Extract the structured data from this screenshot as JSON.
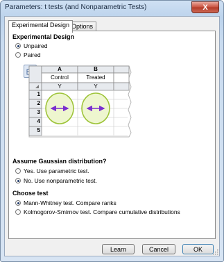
{
  "window": {
    "title": "Parameters: t tests (and Nonparametric Tests)",
    "close_glyph": "X"
  },
  "tabs": [
    {
      "label": "Experimental Design",
      "active": true
    },
    {
      "label": "Options",
      "active": false
    }
  ],
  "experimental_design": {
    "heading": "Experimental Design",
    "options": [
      {
        "label": "Unpaired",
        "checked": true
      },
      {
        "label": "Paired",
        "checked": false
      }
    ]
  },
  "table_preview": {
    "columns": [
      {
        "letter": "A",
        "title": "Control",
        "subhead": "Y"
      },
      {
        "letter": "B",
        "title": "Treated",
        "subhead": "Y"
      }
    ],
    "row_numbers": [
      "1",
      "2",
      "3",
      "4",
      "5"
    ],
    "colors": {
      "accent": "#7a2fcf",
      "ellipse_fill": "#eef6cf",
      "ellipse_stroke": "#9ec43a",
      "header_fill": "#e7eaee"
    }
  },
  "gaussian": {
    "heading": "Assume Gaussian distribution?",
    "options": [
      {
        "label": "Yes. Use parametric test.",
        "checked": false
      },
      {
        "label": "No. Use nonparametric test.",
        "checked": true
      }
    ]
  },
  "choose_test": {
    "heading": "Choose test",
    "options": [
      {
        "label": "Mann-Whitney test. Compare ranks",
        "checked": true
      },
      {
        "label": "Kolmogorov-Smirnov test. Compare cumulative distributions",
        "checked": false
      }
    ]
  },
  "buttons": {
    "learn": "Learn",
    "cancel": "Cancel",
    "ok": "OK"
  }
}
